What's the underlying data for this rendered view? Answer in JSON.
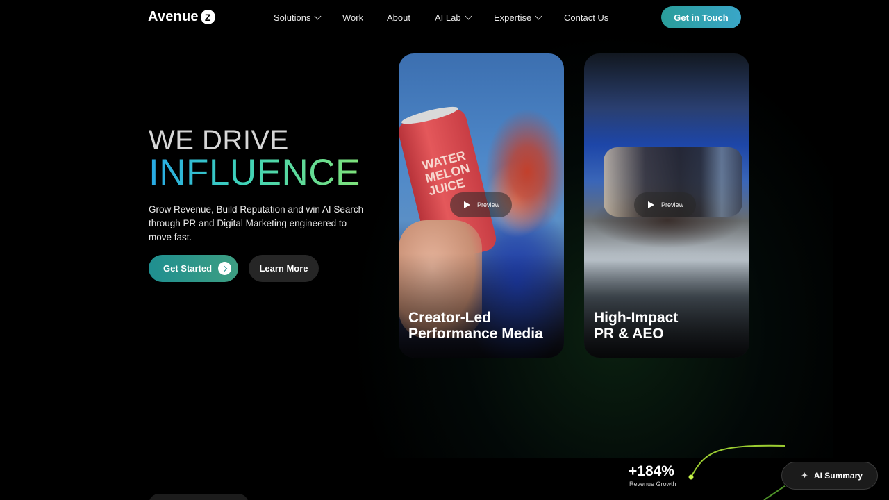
{
  "header": {
    "logo_text": "Avenue",
    "logo_mark": "Z",
    "nav": [
      {
        "label": "Solutions",
        "has_dropdown": true
      },
      {
        "label": "Work",
        "has_dropdown": false
      },
      {
        "label": "About",
        "has_dropdown": false
      },
      {
        "label": "AI Lab",
        "has_dropdown": true
      },
      {
        "label": "Expertise",
        "has_dropdown": true
      },
      {
        "label": "Contact Us",
        "has_dropdown": false
      }
    ],
    "cta_label": "Get in Touch"
  },
  "hero": {
    "line1": "WE DRIVE",
    "line2": "INFLUENCE",
    "subtitle": "Grow Revenue, Build Reputation and win AI Search through PR and Digital Marketing engineered to move fast.",
    "primary_button": "Get Started",
    "secondary_button": "Learn More"
  },
  "cards": [
    {
      "title_line1": "Creator-Led",
      "title_line2": "Performance Media",
      "preview_label": "Preview",
      "image_text": "WATER MELON JUICE"
    },
    {
      "title_line1": "High-Impact",
      "title_line2": "PR & AEO",
      "preview_label": "Preview"
    }
  ],
  "stat": {
    "value": "+184%",
    "label": "Revenue Growth"
  },
  "ai_summary": {
    "label": "AI Summary",
    "icon": "sparkle-icon"
  },
  "colors": {
    "accent_teal": "#2a9d9a",
    "accent_blue": "#3aa6c8",
    "gradient_green": "#7fe27a",
    "curve_green": "#b6f03a"
  }
}
